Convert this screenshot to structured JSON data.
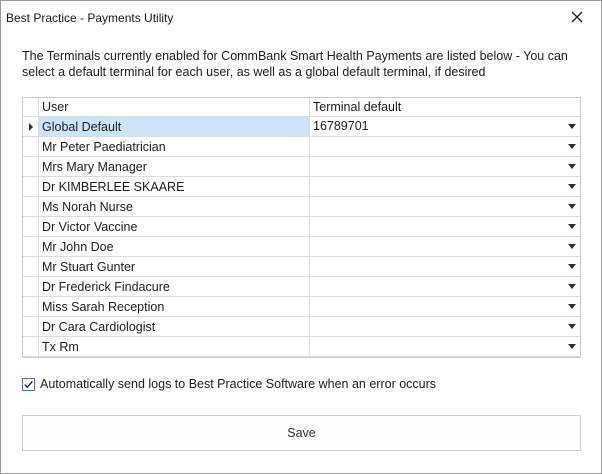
{
  "window": {
    "title": "Best Practice - Payments Utility"
  },
  "description": "The Terminals currently enabled for CommBank Smart Health Payments are listed below - You can select a default terminal for each user, as well as a global default terminal, if desired",
  "grid": {
    "columns": [
      "User",
      "Terminal default"
    ],
    "rows": [
      {
        "user": "Global Default",
        "terminal": "16789701"
      },
      {
        "user": "Mr Peter Paediatrician",
        "terminal": ""
      },
      {
        "user": "Mrs Mary Manager",
        "terminal": ""
      },
      {
        "user": "Dr KIMBERLEE SKAARE",
        "terminal": ""
      },
      {
        "user": "Ms Norah Nurse",
        "terminal": ""
      },
      {
        "user": "Dr Victor Vaccine",
        "terminal": ""
      },
      {
        "user": "Mr John Doe",
        "terminal": ""
      },
      {
        "user": "Mr Stuart Gunter",
        "terminal": ""
      },
      {
        "user": "Dr Frederick Findacure",
        "terminal": ""
      },
      {
        "user": "Miss Sarah Reception",
        "terminal": ""
      },
      {
        "user": "Dr Cara Cardiologist",
        "terminal": ""
      },
      {
        "user": "Tx Rm",
        "terminal": ""
      }
    ]
  },
  "options": {
    "send_logs_label": "Automatically send logs to Best Practice Software when an error occurs",
    "send_logs_checked": true
  },
  "buttons": {
    "save_label": "Save"
  },
  "colors": {
    "selection": "#cce4f7",
    "checkbox_accent": "#3c7fb1"
  },
  "icons": {
    "close": "close-icon",
    "dropdown": "chevron-down-icon",
    "row_indicator": "row-pointer-icon",
    "check": "checkmark-icon"
  }
}
